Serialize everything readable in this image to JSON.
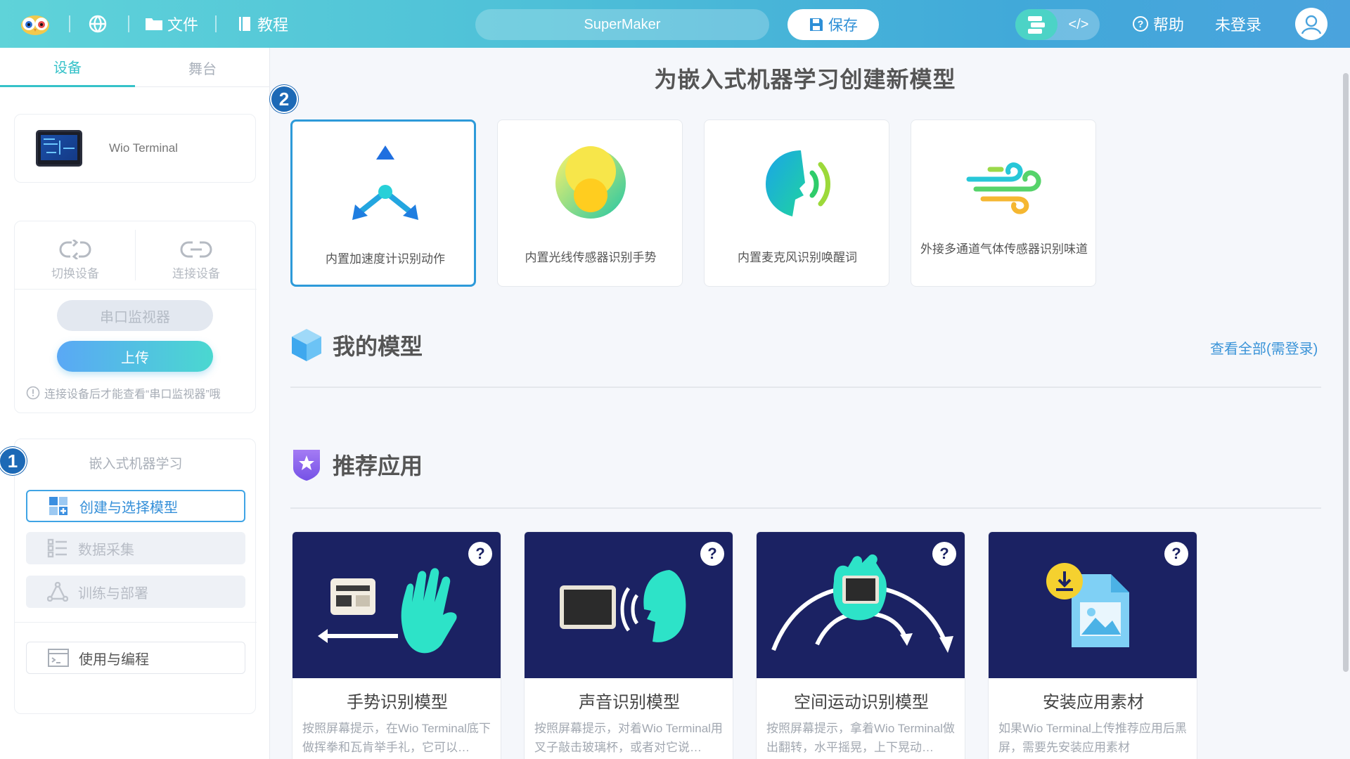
{
  "topbar": {
    "file_label": "文件",
    "tutorial_label": "教程",
    "project_name": "SuperMaker",
    "save_label": "保存",
    "code_icon_text": "</>",
    "help_label": "帮助",
    "login_label": "未登录"
  },
  "sidebar": {
    "tabs": [
      {
        "label": "设备",
        "active": true
      },
      {
        "label": "舞台",
        "active": false
      }
    ],
    "device": {
      "name": "Wio Terminal"
    },
    "connection": {
      "switch_label": "切换设备",
      "connect_label": "连接设备",
      "serial_label": "串口监视器",
      "upload_label": "上传",
      "hint": "连接设备后才能查看“串口监视器”哦"
    },
    "ml": {
      "title": "嵌入式机器学习",
      "items": [
        {
          "label": "创建与选择模型",
          "active": true
        },
        {
          "label": "数据采集",
          "active": false
        },
        {
          "label": "训练与部署",
          "active": false
        }
      ],
      "use_label": "使用与编程"
    }
  },
  "badges": {
    "one": "1",
    "two": "2"
  },
  "main": {
    "title": "为嵌入式机器学习创建新模型",
    "templates": [
      {
        "label": "内置加速度计识别动作",
        "icon": "accelerometer-icon",
        "active": true
      },
      {
        "label": "内置光线传感器识别手势",
        "icon": "light-sensor-icon",
        "active": false
      },
      {
        "label": "内置麦克风识别唤醒词",
        "icon": "microphone-voice-icon",
        "active": false
      },
      {
        "label": "外接多通道气体传感器识别味道",
        "icon": "gas-sensor-icon",
        "active": false
      }
    ],
    "my_models": {
      "title": "我的模型",
      "view_all": "查看全部(需登录)"
    },
    "recommend": {
      "title": "推荐应用",
      "apps": [
        {
          "title": "手势识别模型",
          "desc": "按照屏幕提示，在Wio Terminal底下做挥拳和瓦肯举手礼，它可以…",
          "icon": "hand-gesture-icon"
        },
        {
          "title": "声音识别模型",
          "desc": "按照屏幕提示，对着Wio Terminal用叉子敲击玻璃杯，或者对它说…",
          "icon": "voice-icon"
        },
        {
          "title": "空间运动识别模型",
          "desc": "按照屏幕提示，拿着Wio Terminal做出翻转，水平摇晃，上下晃动…",
          "icon": "motion-icon"
        },
        {
          "title": "安装应用素材",
          "desc": "如果Wio Terminal上传推荐应用后黑屏，需要先安装应用素材",
          "icon": "download-file-icon"
        }
      ],
      "help_glyph": "?"
    }
  },
  "colors": {
    "accent": "#36c2c9",
    "primary": "#2d9ad9",
    "card_dark": "#1b2263",
    "badge": "#1c69b6"
  }
}
